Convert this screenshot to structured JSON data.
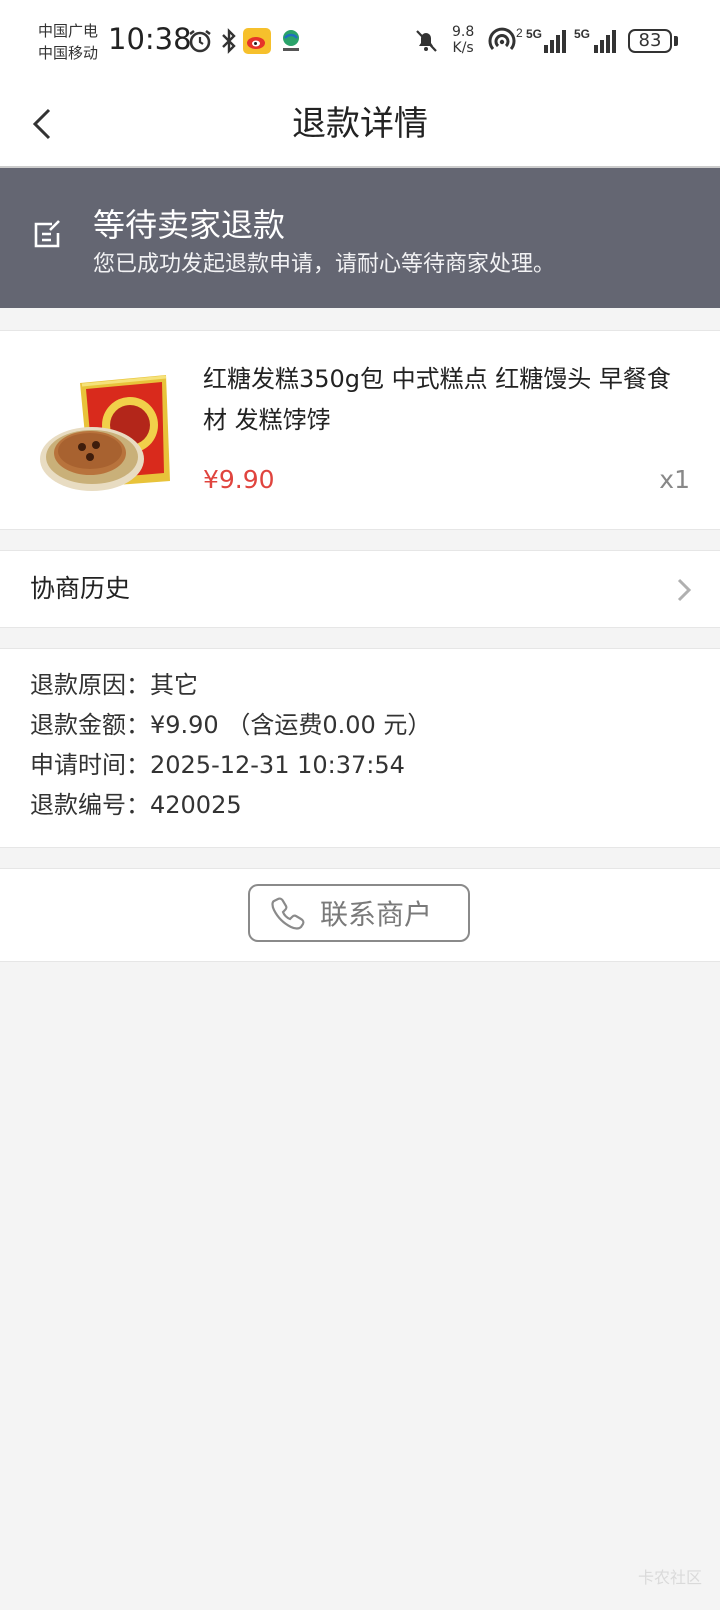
{
  "status_bar": {
    "carrier_1": "中国广电",
    "carrier_2": "中国移动",
    "time": "10:38",
    "net_speed_value": "9.8",
    "net_speed_unit": "K/s",
    "battery": "83",
    "signal_1_label": "5G",
    "signal_2_label": "5G",
    "hotspot_sup": "2"
  },
  "navbar": {
    "title": "退款详情"
  },
  "banner": {
    "title": "等待卖家退款",
    "subtitle": "您已成功发起退款申请，请耐心等待商家处理。"
  },
  "product": {
    "name": "红糖发糕350g包 中式糕点 红糖馒头 早餐食材 发糕饽饽",
    "price": "¥9.90",
    "quantity": "x1"
  },
  "history": {
    "label": "协商历史"
  },
  "refund_info": {
    "reason": "退款原因：其它",
    "amount": "退款金额：¥9.90 （含运费0.00 元）",
    "apply_time": "申请时间：2025-12-31 10:37:54",
    "refund_no": "退款编号：420025"
  },
  "contact": {
    "label": "联系商户"
  },
  "watermark": "卡农社区",
  "colors": {
    "banner_bg": "#646672",
    "price": "#e0443e",
    "page_bg": "#f4f4f4"
  },
  "icons": [
    "back-arrow-icon",
    "edit-note-icon",
    "chevron-right-icon",
    "phone-icon",
    "alarm-icon",
    "bluetooth-icon",
    "weibo-icon",
    "app-logo-icon",
    "mute-bell-icon",
    "hotspot-icon",
    "signal-icon",
    "battery-icon"
  ]
}
